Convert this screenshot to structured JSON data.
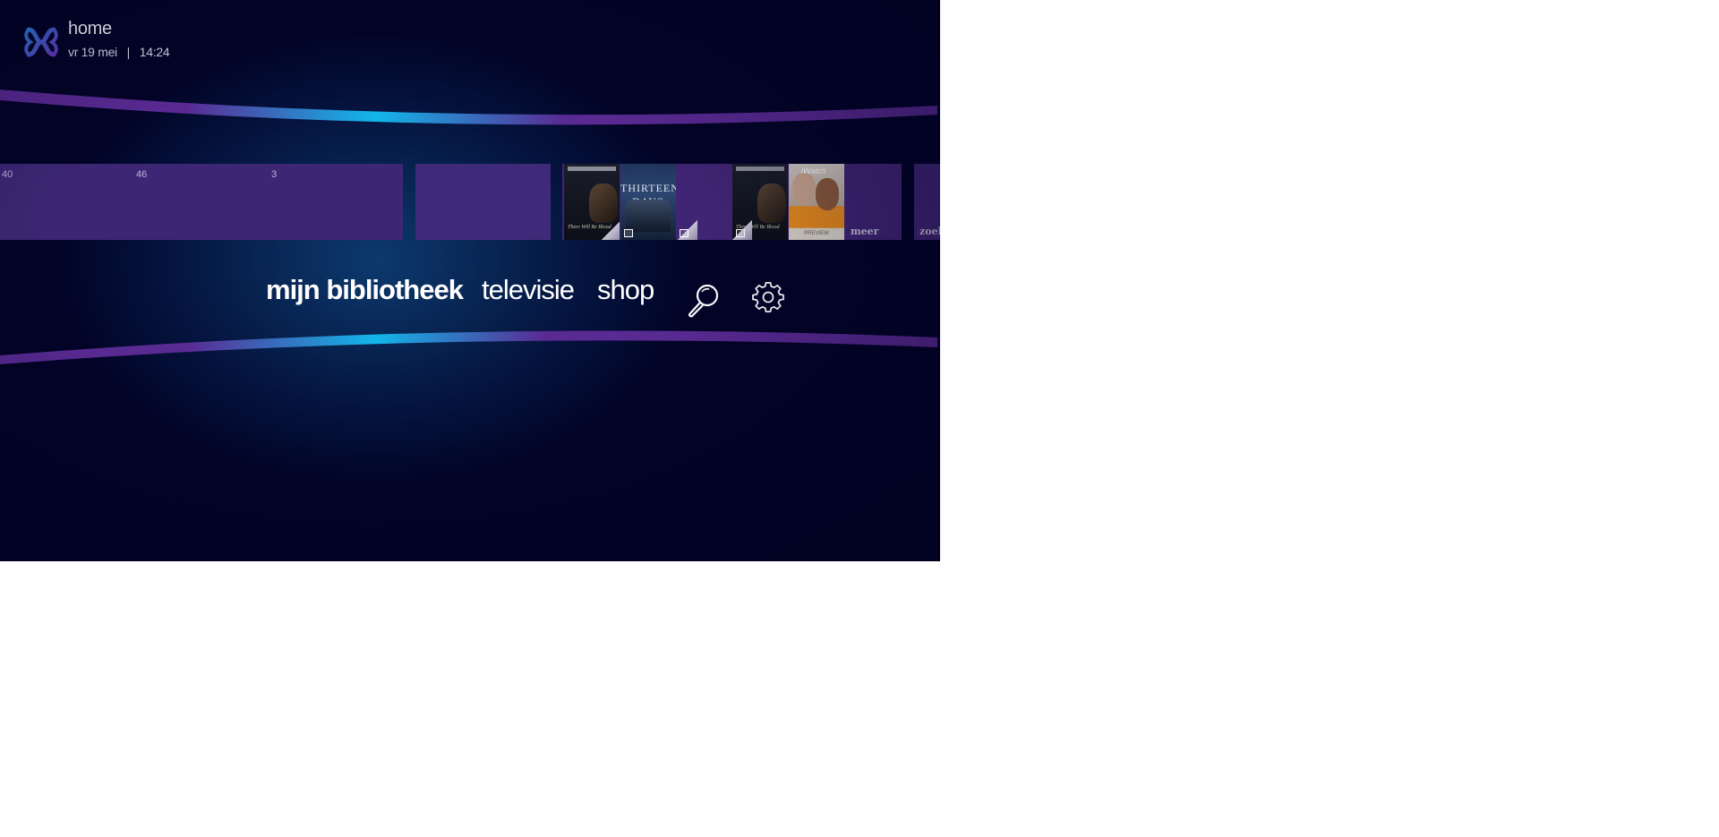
{
  "header": {
    "title": "home",
    "date": "vr 19 mei",
    "separator": "|",
    "time": "14:24",
    "logo_icon": "ziggo-logo-icon"
  },
  "colors": {
    "background": "#04113b",
    "tile": "#3d2775",
    "arc_cyan": "#12b7ea",
    "arc_purple": "#5a2a93"
  },
  "carousel": {
    "counts": [
      "40",
      "46",
      "3"
    ],
    "tiles": [
      {
        "posters": [
          "There Will Be Blood",
          "Thirteen Days"
        ]
      },
      {
        "posters": [
          "There Will Be Blood",
          "iWatch"
        ],
        "label": "meer"
      },
      {
        "label": "zoek"
      }
    ],
    "poster_texts": {
      "blood_title": "There Will Be Blood",
      "days_title": "THIRTEEN DAYS",
      "watch_title": "iWatch",
      "watch_badge": "PREVIEW"
    }
  },
  "menu": {
    "items": [
      {
        "label": "mijn bibliotheek",
        "active": true
      },
      {
        "label": "televisie",
        "active": false
      },
      {
        "label": "shop",
        "active": false
      }
    ],
    "icons": [
      "search-icon",
      "gear-icon"
    ]
  }
}
